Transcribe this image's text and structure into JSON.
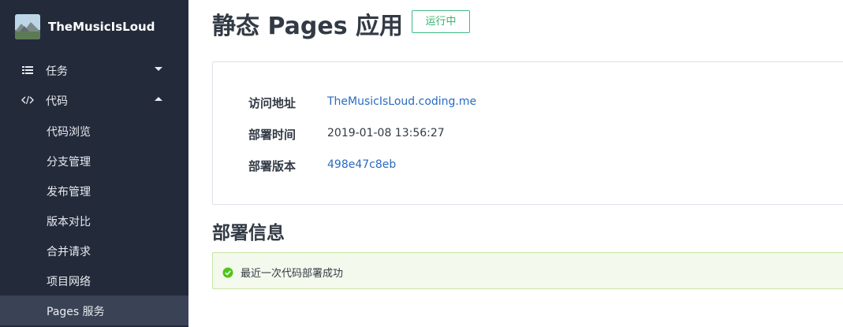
{
  "project": {
    "name": "TheMusicIsLoud"
  },
  "sidebar": {
    "items": [
      {
        "label": "任务",
        "icon": "list-icon",
        "state": "collapsed"
      },
      {
        "label": "代码",
        "icon": "code-icon",
        "state": "expanded"
      }
    ],
    "code_submenu": [
      {
        "label": "代码浏览"
      },
      {
        "label": "分支管理"
      },
      {
        "label": "发布管理"
      },
      {
        "label": "版本对比"
      },
      {
        "label": "合并请求"
      },
      {
        "label": "项目网络"
      },
      {
        "label": "Pages 服务",
        "active": true
      }
    ]
  },
  "main": {
    "title": "静态 Pages 应用",
    "status": "运行中",
    "info": {
      "url_label": "访问地址",
      "url_value": "TheMusicIsLoud.coding.me",
      "time_label": "部署时间",
      "time_value": "2019-01-08 13:56:27",
      "version_label": "部署版本",
      "version_value": "498e47c8eb"
    },
    "deploy_section_title": "部署信息",
    "deploy_message": "最近一次代码部署成功"
  },
  "colors": {
    "sidebar_bg": "#232b3b",
    "sidebar_active_bg": "#3a4355",
    "link": "#2a6bc0",
    "success": "#42b983",
    "alert_bg": "#f3f9ec"
  }
}
